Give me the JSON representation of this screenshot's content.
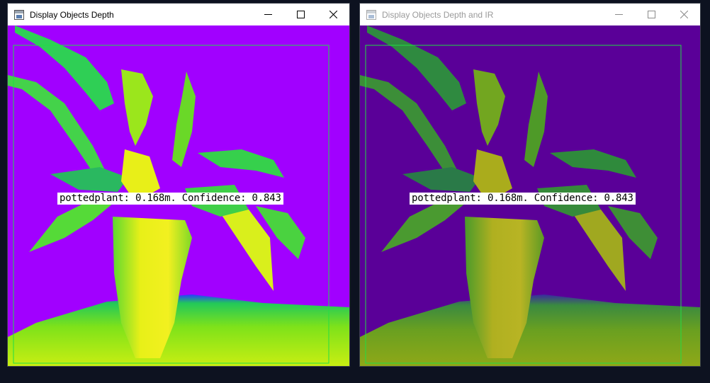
{
  "windows": [
    {
      "title": "Display Objects Depth",
      "active": true,
      "detection": {
        "class": "pottedplant",
        "label": "pottedplant: 0.168m. Confidence: 0.843"
      },
      "colors": {
        "background": "#a100ff",
        "bbox": "#22dd44"
      }
    },
    {
      "title": "Display Objects Depth and IR",
      "active": false,
      "detection": {
        "class": "pottedplant",
        "label": "pottedplant: 0.168m. Confidence: 0.843"
      },
      "colors": {
        "background": "#5a0098",
        "bbox": "#22dd44"
      }
    }
  ],
  "desktop": {
    "background": "#0d1220"
  }
}
